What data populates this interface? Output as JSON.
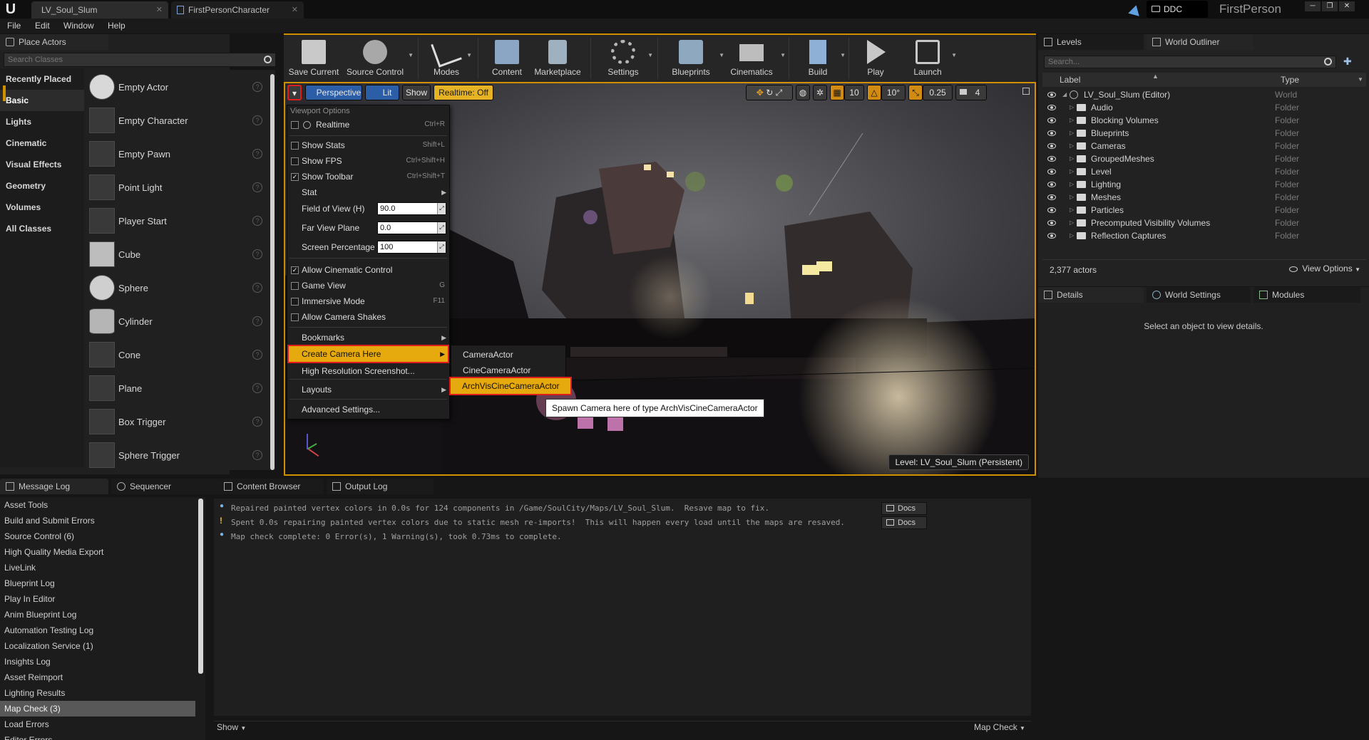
{
  "titlebar": {
    "tabs": [
      "LV_Soul_Slum",
      "FirstPersonCharacter"
    ],
    "ddc": "DDC",
    "project": "FirstPerson"
  },
  "menubar": {
    "items": [
      "File",
      "Edit",
      "Window",
      "Help"
    ]
  },
  "place_actors": {
    "tab": "Place Actors",
    "search_placeholder": "Search Classes",
    "categories": [
      "Recently Placed",
      "Basic",
      "Lights",
      "Cinematic",
      "Visual Effects",
      "Geometry",
      "Volumes",
      "All Classes"
    ],
    "selected_category": "Basic",
    "actors": [
      "Empty Actor",
      "Empty Character",
      "Empty Pawn",
      "Point Light",
      "Player Start",
      "Cube",
      "Sphere",
      "Cylinder",
      "Cone",
      "Plane",
      "Box Trigger",
      "Sphere Trigger"
    ]
  },
  "toolbar": {
    "buttons": [
      "Save Current",
      "Source Control",
      "Modes",
      "Content",
      "Marketplace",
      "Settings",
      "Blueprints",
      "Cinematics",
      "Build",
      "Play",
      "Launch"
    ]
  },
  "viewport": {
    "perspective": "Perspective",
    "lit": "Lit",
    "show": "Show",
    "realtime": "Realtime: Off",
    "grid": "10",
    "angle": "10°",
    "scale": "0.25",
    "cam_speed": "4",
    "level": "Level:  LV_Soul_Slum (Persistent)"
  },
  "viewport_menu": {
    "header": "Viewport Options",
    "realtime": "Realtime",
    "realtime_sc": "Ctrl+R",
    "show_stats": "Show Stats",
    "show_stats_sc": "Shift+L",
    "show_fps": "Show FPS",
    "show_fps_sc": "Ctrl+Shift+H",
    "show_toolbar": "Show Toolbar",
    "show_toolbar_sc": "Ctrl+Shift+T",
    "stat": "Stat",
    "fov": "Field of View (H)",
    "fov_value": "90.0",
    "far_view": "Far View Plane",
    "far_view_value": "0.0",
    "screen_pct": "Screen Percentage",
    "screen_pct_value": "100",
    "allow_cine": "Allow Cinematic Control",
    "game_view": "Game View",
    "game_view_sc": "G",
    "immersive": "Immersive Mode",
    "immersive_sc": "F11",
    "camera_shakes": "Allow Camera Shakes",
    "bookmarks": "Bookmarks",
    "create_camera": "Create Camera Here",
    "hires": "High Resolution Screenshot...",
    "layouts": "Layouts",
    "advanced": "Advanced Settings..."
  },
  "camera_submenu": {
    "items": [
      "CameraActor",
      "CineCameraActor",
      "ArchVisCineCameraActor"
    ],
    "tooltip": "Spawn Camera here of type ArchVisCineCameraActor"
  },
  "levels_tab": "Levels",
  "outliner": {
    "tab": "World Outliner",
    "search_placeholder": "Search...",
    "col_label": "Label",
    "col_type": "Type",
    "root": "LV_Soul_Slum (Editor)",
    "root_type": "World",
    "folders": [
      "Audio",
      "Blocking Volumes",
      "Blueprints",
      "Cameras",
      "GroupedMeshes",
      "Level",
      "Lighting",
      "Meshes",
      "Particles",
      "Precomputed Visibility Volumes",
      "Reflection Captures"
    ],
    "folder_type": "Folder",
    "actor_count": "2,377 actors",
    "view_options": "View Options"
  },
  "details": {
    "tabs": [
      "Details",
      "World Settings",
      "Modules"
    ],
    "empty": "Select an object to view details."
  },
  "bottom": {
    "tabs": [
      "Message Log",
      "Sequencer",
      "Content Browser",
      "Output Log"
    ],
    "categories": [
      "Asset Tools",
      "Build and Submit Errors",
      "Source Control (6)",
      "High Quality Media Export",
      "LiveLink",
      "Blueprint Log",
      "Play In Editor",
      "Anim Blueprint Log",
      "Automation Testing Log",
      "Localization Service (1)",
      "Insights Log",
      "Asset Reimport",
      "Lighting Results",
      "Map Check (3)",
      "Load Errors",
      "Editor Errors"
    ],
    "selected_category": "Map Check (3)",
    "lines": [
      "Repaired painted vertex colors in 0.0s for 124 components in /Game/SoulCity/Maps/LV_Soul_Slum.  Resave map to fix.",
      "Spent 0.0s repairing painted vertex colors due to static mesh re-imports!  This will happen every load until the maps are resaved.",
      "Map check complete: 0 Error(s), 1 Warning(s), took 0.73ms to complete."
    ],
    "docs": "Docs",
    "show": "Show",
    "map_check": "Map Check"
  },
  "colors": {
    "accent": "#d09000",
    "highlight": "#e6a90e",
    "callout": "#e01d1d"
  }
}
